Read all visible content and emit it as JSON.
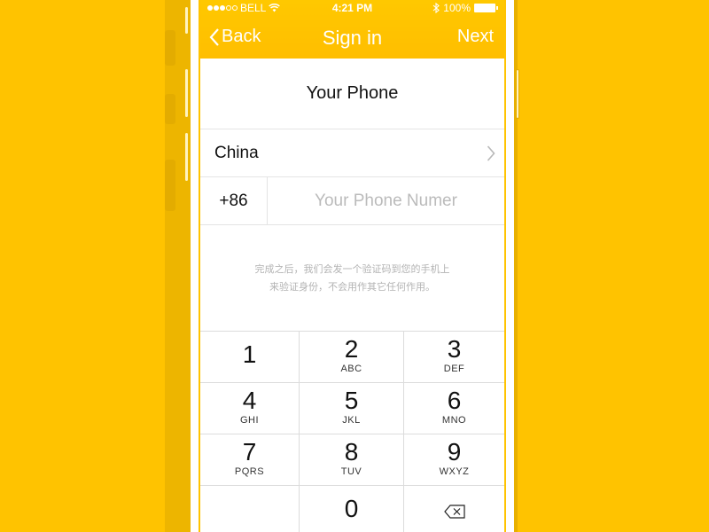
{
  "status_bar": {
    "carrier": "BELL",
    "signal_filled": 3,
    "signal_total": 5,
    "time": "4:21 PM",
    "battery": "100%",
    "icons": [
      "wifi-icon",
      "bluetooth-icon",
      "battery-icon"
    ]
  },
  "nav": {
    "back_label": "Back",
    "title": "Sign in",
    "next_label": "Next"
  },
  "form": {
    "heading": "Your Phone",
    "country": "China",
    "country_code": "+86",
    "phone_value": "",
    "phone_placeholder": "Your Phone Numer"
  },
  "note": {
    "line1": "完成之后，我们会发一个验证码到您的手机上",
    "line2": "来验证身份，不会用作其它任何作用。"
  },
  "keypad": [
    {
      "digit": "1",
      "letters": ""
    },
    {
      "digit": "2",
      "letters": "ABC"
    },
    {
      "digit": "3",
      "letters": "DEF"
    },
    {
      "digit": "4",
      "letters": "GHI"
    },
    {
      "digit": "5",
      "letters": "JKL"
    },
    {
      "digit": "6",
      "letters": "MNO"
    },
    {
      "digit": "7",
      "letters": "PQRS"
    },
    {
      "digit": "8",
      "letters": "TUV"
    },
    {
      "digit": "9",
      "letters": "WXYZ"
    },
    {
      "digit": "",
      "letters": ""
    },
    {
      "digit": "0",
      "letters": ""
    },
    {
      "digit": "",
      "letters": "",
      "icon": "backspace-icon"
    }
  ],
  "colors": {
    "accent": "#FFC300",
    "side_band": "#EDB500",
    "divider": "#E4E4E4",
    "placeholder": "#BBBBBB"
  }
}
